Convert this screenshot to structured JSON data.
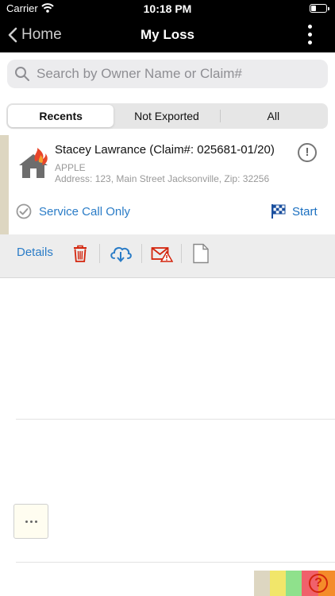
{
  "status_bar": {
    "carrier": "Carrier",
    "time": "10:18 PM"
  },
  "nav": {
    "back_label": "Home",
    "title": "My Loss"
  },
  "search": {
    "placeholder": "Search by Owner Name or Claim#"
  },
  "tabs": [
    {
      "label": "Recents",
      "active": true
    },
    {
      "label": "Not Exported",
      "active": false
    },
    {
      "label": "All",
      "active": false
    }
  ],
  "claim": {
    "title": "Stacey Lawrance (Claim#: 025681-01/20)",
    "company": "APPLE",
    "address": "Address: 123, Main Street Jacksonville, Zip: 32256",
    "service_label": "Service Call Only",
    "start_label": "Start",
    "icon": "house-fire-icon",
    "strip_color": "#ddd6c1"
  },
  "actions": {
    "details_label": "Details",
    "icons": [
      "trash-icon",
      "cloud-download-icon",
      "mail-alert-icon",
      "document-icon"
    ]
  },
  "colors": {
    "accent": "#2a7cc7",
    "danger": "#d3240c",
    "legend": [
      "#ddd6c1",
      "#f1e66a",
      "#8fe18c",
      "#f0616b",
      "#f48c2a"
    ]
  }
}
